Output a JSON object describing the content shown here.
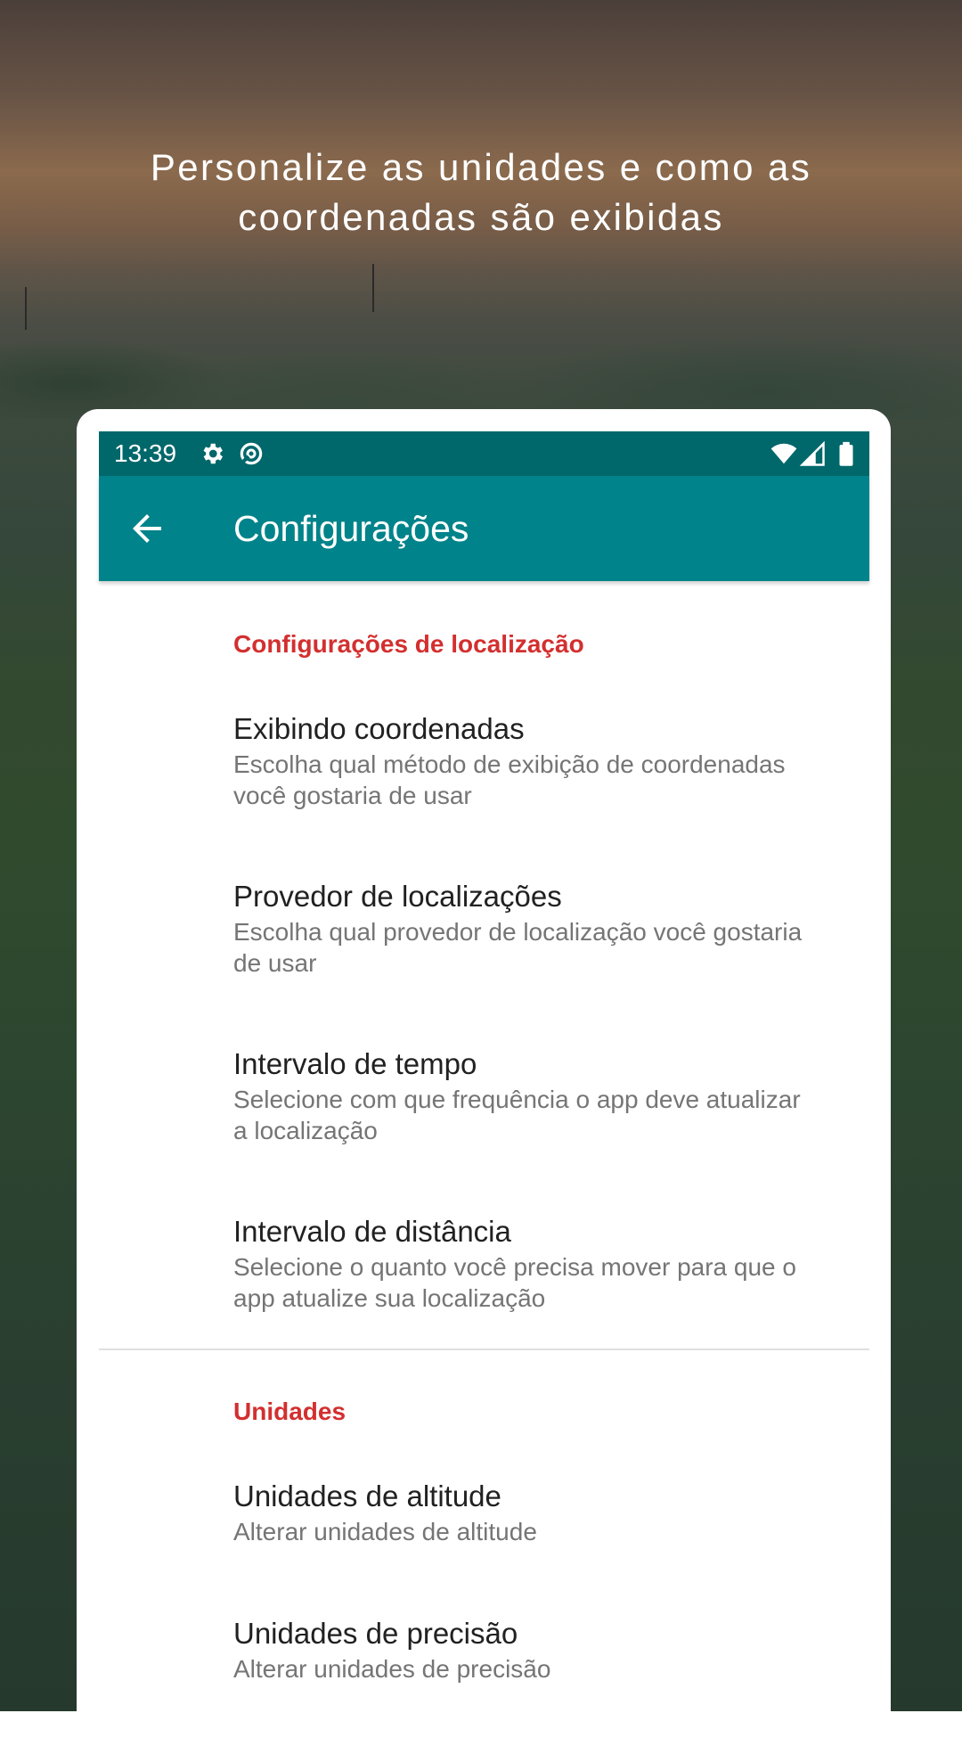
{
  "headline": {
    "line1": "Personalize as unidades e como as",
    "line2": "coordenadas são exibidas"
  },
  "status_bar": {
    "time": "13:39",
    "left_icons": [
      "gear-icon",
      "data-saver-icon"
    ],
    "right_icons": [
      "wifi-icon",
      "signal-icon",
      "battery-icon"
    ]
  },
  "app_bar": {
    "back_icon": "arrow-left-icon",
    "title": "Configurações",
    "color": "#00838a",
    "status_color": "#00676b"
  },
  "sections": [
    {
      "header": "Configurações de localização",
      "items": [
        {
          "title": "Exibindo coordenadas",
          "summary_line1": "Escolha qual método de exibição de coordenadas",
          "summary_line2": "você gostaria de usar"
        },
        {
          "title": "Provedor de localizações",
          "summary_line1": "Escolha qual provedor de localização você gostaria",
          "summary_line2": "de usar"
        },
        {
          "title": "Intervalo de tempo",
          "summary_line1": "Selecione com que frequência o app deve atualizar",
          "summary_line2": "a localização"
        },
        {
          "title": "Intervalo de distância",
          "summary_line1": "Selecione o quanto você precisa mover para que o",
          "summary_line2": "app atualize sua localização"
        }
      ]
    },
    {
      "header": "Unidades",
      "items": [
        {
          "title": "Unidades de altitude",
          "summary_line1": "Alterar unidades de altitude"
        },
        {
          "title": "Unidades de precisão",
          "summary_line1": "Alterar unidades de precisão"
        }
      ]
    }
  ],
  "accent_color": "#d32f2f"
}
